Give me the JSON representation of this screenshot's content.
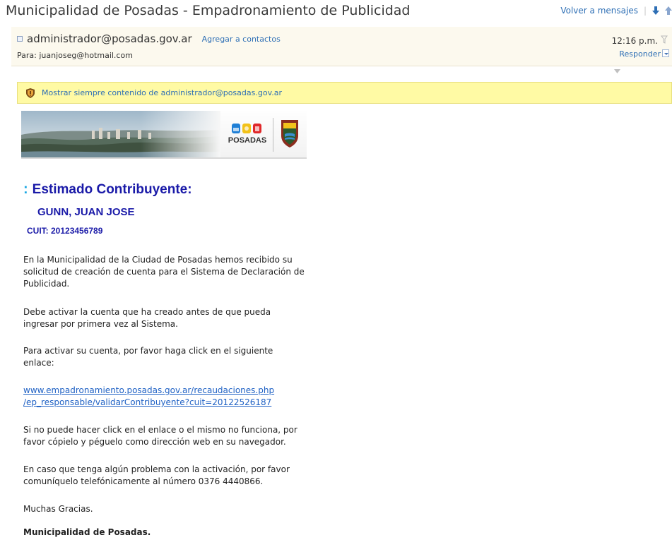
{
  "subject": "Municipalidad de Posadas - Empadronamiento de Publicidad",
  "top_actions": {
    "back_label": "Volver a mensajes",
    "sep": "|"
  },
  "header": {
    "sender": "administrador@posadas.gov.ar",
    "add_contact": "Agregar a contactos",
    "to": "Para: juanjoseg@hotmail.com",
    "time": "12:16 p.m.",
    "reply": "Responder"
  },
  "notice": {
    "text": "Mostrar siempre contenido de administrador@posadas.gov.ar"
  },
  "banner": {
    "logo_text": "POSADAS"
  },
  "message": {
    "greeting_colon": ":",
    "greeting": "Estimado Contribuyente:",
    "name": "GUNN, JUAN JOSE",
    "cuit": "CUIT: 20123456789",
    "p1": "En la Municipalidad de la Ciudad de Posadas hemos recibido su solicitud de creación de cuenta para el Sistema de Declaración de Publicidad.",
    "p2": "Debe activar la cuenta que ha creado antes de que pueda ingresar por primera vez al Sistema.",
    "p3": "Para activar su cuenta, por favor haga click en el siguiente enlace:",
    "link_line1": "www.empadronamiento.posadas.gov.ar/recaudaciones.php",
    "link_line2": "/ep_responsable/validarContribuyente?cuit=20122526187",
    "p4": "Si no puede hacer click en el enlace o el mismo no funciona, por favor cópielo y péguelo como dirección web en su navegador.",
    "p5": "En caso que tenga algún problema con la activación, por favor comuníquelo telefónicamente al número 0376 4440866.",
    "p6": "Muchas Gracias.",
    "signature": "Municipalidad de Posadas."
  },
  "colors": {
    "accent_link": "#2e6fb5",
    "heading_blue": "#1a1aa8",
    "notice_yellow": "#fffaa4",
    "header_bg": "#fcf9ee"
  }
}
